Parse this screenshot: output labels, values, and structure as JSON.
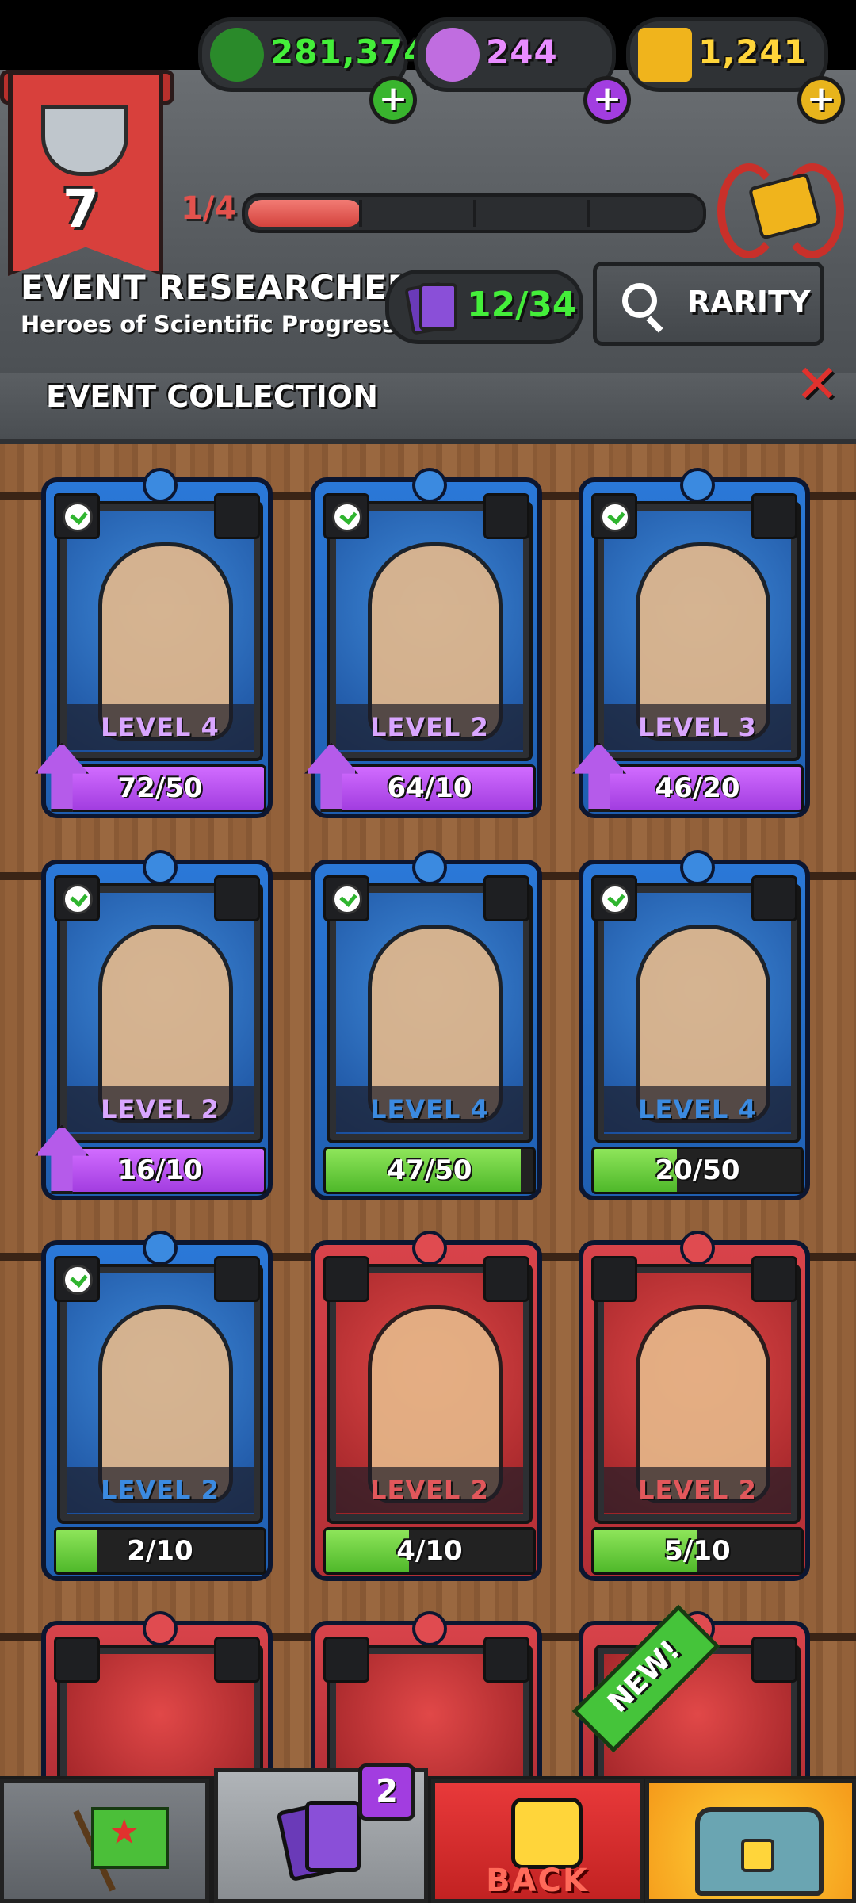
{
  "header": {
    "currencies": [
      {
        "name": "green-hat-currency",
        "value": "281,374",
        "color": "#44ee3a"
      },
      {
        "name": "potion-currency",
        "value": "244",
        "color": "#e98cff"
      },
      {
        "name": "gold-currency",
        "value": "1,241",
        "color": "#ffd53a"
      }
    ],
    "banner_level": "7",
    "progress": {
      "label": "1/4",
      "fraction": 0.25
    },
    "event_title": "EVENT RESEARCHERS",
    "event_subtitle": "Heroes of Scientific Progress",
    "collection_count": "12/34",
    "rarity_button": "RARITY"
  },
  "section": {
    "title": "EVENT COLLECTION"
  },
  "cards": [
    {
      "level": "LEVEL 4",
      "count": "72/50",
      "fill": 1.0,
      "rarity": "blue",
      "bar": "purple",
      "upgrade": true
    },
    {
      "level": "LEVEL 2",
      "count": "64/10",
      "fill": 1.0,
      "rarity": "blue",
      "bar": "purple",
      "upgrade": true
    },
    {
      "level": "LEVEL 3",
      "count": "46/20",
      "fill": 1.0,
      "rarity": "blue",
      "bar": "purple",
      "upgrade": true
    },
    {
      "level": "LEVEL 2",
      "count": "16/10",
      "fill": 1.0,
      "rarity": "blue",
      "bar": "purple",
      "upgrade": true
    },
    {
      "level": "LEVEL 4",
      "count": "47/50",
      "fill": 0.94,
      "rarity": "blue",
      "bar": "green",
      "upgrade": false
    },
    {
      "level": "LEVEL 4",
      "count": "20/50",
      "fill": 0.4,
      "rarity": "blue",
      "bar": "green",
      "upgrade": false
    },
    {
      "level": "LEVEL 2",
      "count": "2/10",
      "fill": 0.2,
      "rarity": "blue",
      "bar": "green",
      "upgrade": false
    },
    {
      "level": "LEVEL 2",
      "count": "4/10",
      "fill": 0.4,
      "rarity": "red",
      "bar": "green",
      "upgrade": false
    },
    {
      "level": "LEVEL 2",
      "count": "5/10",
      "fill": 0.5,
      "rarity": "red",
      "bar": "green",
      "upgrade": false
    }
  ],
  "new_badge": "NEW!",
  "nav": {
    "cards_badge": "2",
    "back_label": "BACK"
  }
}
